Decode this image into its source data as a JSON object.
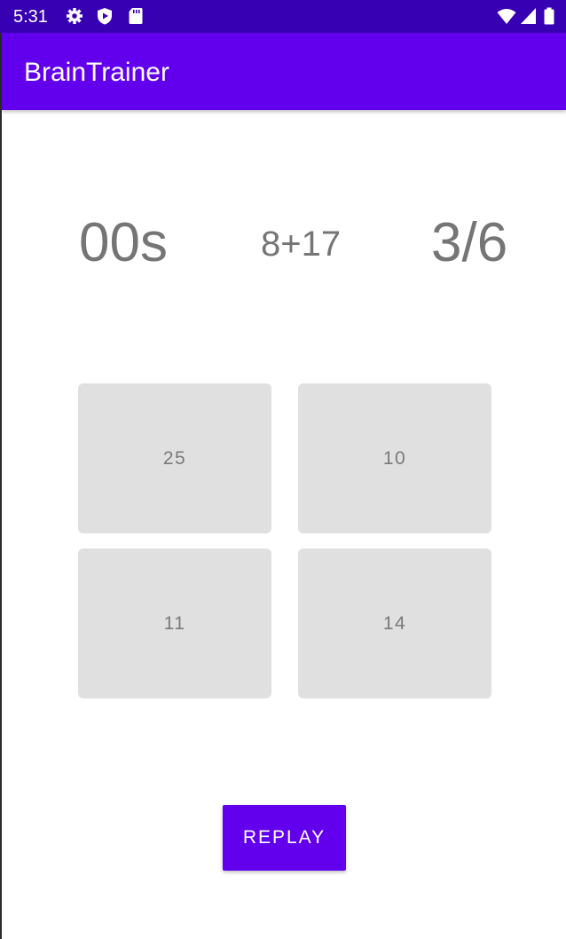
{
  "status_bar": {
    "time": "5:31",
    "left_icons": [
      "gear-icon",
      "shield-play-icon",
      "sd-card-icon"
    ],
    "right_icons": [
      "wifi-icon",
      "cell-signal-icon",
      "battery-icon"
    ],
    "background": "#3700b3"
  },
  "app_bar": {
    "title": "BrainTrainer",
    "background": "#6200ee"
  },
  "game": {
    "timer": "00s",
    "question": "8+17",
    "score": "3/6",
    "answers": [
      "25",
      "10",
      "11",
      "14"
    ],
    "replay_label": "REPLAY"
  },
  "colors": {
    "accent": "#6200ee",
    "answer_bg": "#e0e0e0",
    "text_gray": "#757575"
  }
}
